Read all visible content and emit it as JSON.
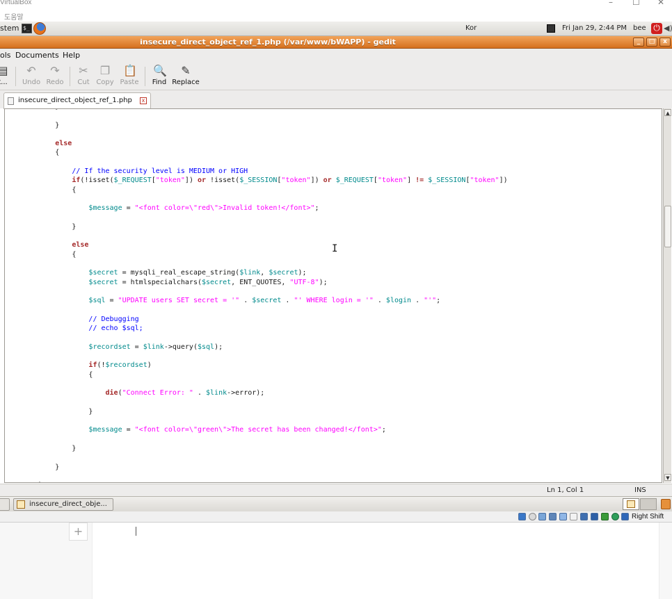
{
  "host": {
    "title": "VirtualBox",
    "menu_help": "도움말",
    "controls": {
      "minimize": "–",
      "maximize": "☐",
      "close": "✕"
    }
  },
  "guest_panel": {
    "system_label": "stem",
    "terminal_glyph": "$_",
    "keyboard": "Kor",
    "clock": "Fri Jan 29,  2:44 PM",
    "user": "bee",
    "power_glyph": "⏻",
    "speaker_glyph": "◀)"
  },
  "window": {
    "title": "insecure_direct_object_ref_1.php (/var/www/bWAPP) - gedit",
    "controls": {
      "minimize": "_",
      "maximize": "□",
      "close": "x"
    }
  },
  "menu": [
    "ols",
    "Documents",
    "Help"
  ],
  "toolbar": {
    "partial_label": "t...",
    "undo": "Undo",
    "redo": "Redo",
    "cut": "Cut",
    "copy": "Copy",
    "paste": "Paste",
    "find": "Find",
    "replace": "Replace"
  },
  "tab": {
    "name": "insecure_direct_object_ref_1.php",
    "close_glyph": "x"
  },
  "editor": {
    "lines": [
      [
        {
          "t": "            }",
          "c": ""
        }
      ],
      [
        {
          "t": "",
          "c": ""
        }
      ],
      [
        {
          "t": "            }",
          "c": ""
        }
      ],
      [
        {
          "t": "",
          "c": ""
        }
      ],
      [
        {
          "t": "            ",
          "c": ""
        },
        {
          "t": "else",
          "c": "kw"
        }
      ],
      [
        {
          "t": "            {",
          "c": ""
        }
      ],
      [
        {
          "t": "",
          "c": ""
        }
      ],
      [
        {
          "t": "                ",
          "c": ""
        },
        {
          "t": "// If the security level is MEDIUM or HIGH",
          "c": "com"
        }
      ],
      [
        {
          "t": "                ",
          "c": ""
        },
        {
          "t": "if",
          "c": "kw"
        },
        {
          "t": "(!isset(",
          "c": ""
        },
        {
          "t": "$_REQUEST",
          "c": "var"
        },
        {
          "t": "[",
          "c": ""
        },
        {
          "t": "\"token\"",
          "c": "str"
        },
        {
          "t": "]) ",
          "c": ""
        },
        {
          "t": "or",
          "c": "kw"
        },
        {
          "t": " !isset(",
          "c": ""
        },
        {
          "t": "$_SESSION",
          "c": "var"
        },
        {
          "t": "[",
          "c": ""
        },
        {
          "t": "\"token\"",
          "c": "str"
        },
        {
          "t": "]) ",
          "c": ""
        },
        {
          "t": "or",
          "c": "kw"
        },
        {
          "t": " ",
          "c": ""
        },
        {
          "t": "$_REQUEST",
          "c": "var"
        },
        {
          "t": "[",
          "c": ""
        },
        {
          "t": "\"token\"",
          "c": "str"
        },
        {
          "t": "] ",
          "c": ""
        },
        {
          "t": "!=",
          "c": "kw"
        },
        {
          "t": " ",
          "c": ""
        },
        {
          "t": "$_SESSION",
          "c": "var"
        },
        {
          "t": "[",
          "c": ""
        },
        {
          "t": "\"token\"",
          "c": "str"
        },
        {
          "t": "])",
          "c": ""
        }
      ],
      [
        {
          "t": "                {",
          "c": ""
        }
      ],
      [
        {
          "t": "",
          "c": ""
        }
      ],
      [
        {
          "t": "                    ",
          "c": ""
        },
        {
          "t": "$message",
          "c": "var"
        },
        {
          "t": " = ",
          "c": ""
        },
        {
          "t": "\"<font color=\\\"red\\\">Invalid token!</font>\"",
          "c": "str"
        },
        {
          "t": ";",
          "c": ""
        }
      ],
      [
        {
          "t": "",
          "c": ""
        }
      ],
      [
        {
          "t": "                }",
          "c": ""
        }
      ],
      [
        {
          "t": "",
          "c": ""
        }
      ],
      [
        {
          "t": "                ",
          "c": ""
        },
        {
          "t": "else",
          "c": "kw"
        }
      ],
      [
        {
          "t": "                {",
          "c": ""
        }
      ],
      [
        {
          "t": "",
          "c": ""
        }
      ],
      [
        {
          "t": "                    ",
          "c": ""
        },
        {
          "t": "$secret",
          "c": "var"
        },
        {
          "t": " = mysqli_real_escape_string(",
          "c": ""
        },
        {
          "t": "$link",
          "c": "var"
        },
        {
          "t": ", ",
          "c": ""
        },
        {
          "t": "$secret",
          "c": "var"
        },
        {
          "t": ");",
          "c": ""
        }
      ],
      [
        {
          "t": "                    ",
          "c": ""
        },
        {
          "t": "$secret",
          "c": "var"
        },
        {
          "t": " = htmlspecialchars(",
          "c": ""
        },
        {
          "t": "$secret",
          "c": "var"
        },
        {
          "t": ", ENT_QUOTES, ",
          "c": ""
        },
        {
          "t": "\"UTF-8\"",
          "c": "str"
        },
        {
          "t": ");",
          "c": ""
        }
      ],
      [
        {
          "t": "",
          "c": ""
        }
      ],
      [
        {
          "t": "                    ",
          "c": ""
        },
        {
          "t": "$sql",
          "c": "var"
        },
        {
          "t": " = ",
          "c": ""
        },
        {
          "t": "\"UPDATE users SET secret = '\"",
          "c": "str"
        },
        {
          "t": " . ",
          "c": ""
        },
        {
          "t": "$secret",
          "c": "var"
        },
        {
          "t": " . ",
          "c": ""
        },
        {
          "t": "\"' WHERE login = '\"",
          "c": "str"
        },
        {
          "t": " . ",
          "c": ""
        },
        {
          "t": "$login",
          "c": "var"
        },
        {
          "t": " . ",
          "c": ""
        },
        {
          "t": "\"'\"",
          "c": "str"
        },
        {
          "t": ";",
          "c": ""
        }
      ],
      [
        {
          "t": "",
          "c": ""
        }
      ],
      [
        {
          "t": "                    ",
          "c": ""
        },
        {
          "t": "// Debugging",
          "c": "com"
        }
      ],
      [
        {
          "t": "                    ",
          "c": ""
        },
        {
          "t": "// echo $sql;",
          "c": "com"
        }
      ],
      [
        {
          "t": "",
          "c": ""
        }
      ],
      [
        {
          "t": "                    ",
          "c": ""
        },
        {
          "t": "$recordset",
          "c": "var"
        },
        {
          "t": " = ",
          "c": ""
        },
        {
          "t": "$link",
          "c": "var"
        },
        {
          "t": "->query(",
          "c": ""
        },
        {
          "t": "$sql",
          "c": "var"
        },
        {
          "t": ");",
          "c": ""
        }
      ],
      [
        {
          "t": "",
          "c": ""
        }
      ],
      [
        {
          "t": "                    ",
          "c": ""
        },
        {
          "t": "if",
          "c": "kw"
        },
        {
          "t": "(!",
          "c": ""
        },
        {
          "t": "$recordset",
          "c": "var"
        },
        {
          "t": ")",
          "c": ""
        }
      ],
      [
        {
          "t": "                    {",
          "c": ""
        }
      ],
      [
        {
          "t": "",
          "c": ""
        }
      ],
      [
        {
          "t": "                        ",
          "c": ""
        },
        {
          "t": "die",
          "c": "kw"
        },
        {
          "t": "(",
          "c": ""
        },
        {
          "t": "\"Connect Error: \"",
          "c": "str"
        },
        {
          "t": " . ",
          "c": ""
        },
        {
          "t": "$link",
          "c": "var"
        },
        {
          "t": "->error);",
          "c": ""
        }
      ],
      [
        {
          "t": "",
          "c": ""
        }
      ],
      [
        {
          "t": "                    }",
          "c": ""
        }
      ],
      [
        {
          "t": "",
          "c": ""
        }
      ],
      [
        {
          "t": "                    ",
          "c": ""
        },
        {
          "t": "$message",
          "c": "var"
        },
        {
          "t": " = ",
          "c": ""
        },
        {
          "t": "\"<font color=\\\"green\\\">The secret has been changed!</font>\"",
          "c": "str"
        },
        {
          "t": ";",
          "c": ""
        }
      ],
      [
        {
          "t": "",
          "c": ""
        }
      ],
      [
        {
          "t": "                }",
          "c": ""
        }
      ],
      [
        {
          "t": "",
          "c": ""
        }
      ],
      [
        {
          "t": "            }",
          "c": ""
        }
      ],
      [
        {
          "t": "",
          "c": ""
        }
      ],
      [
        {
          "t": "        }",
          "c": ""
        }
      ]
    ]
  },
  "status": {
    "position": "Ln 1, Col 1",
    "mode": "INS"
  },
  "taskbar": {
    "item": "insecure_direct_obje..."
  },
  "vbox_status": {
    "host_key": "Right Shift"
  },
  "host_app": {
    "add_glyph": "+"
  },
  "colors": {
    "title_orange": "#e0812c",
    "keyword": "#a52a2a",
    "variable": "#008a8c",
    "string": "#ff00ff",
    "comment": "#0000ff"
  }
}
